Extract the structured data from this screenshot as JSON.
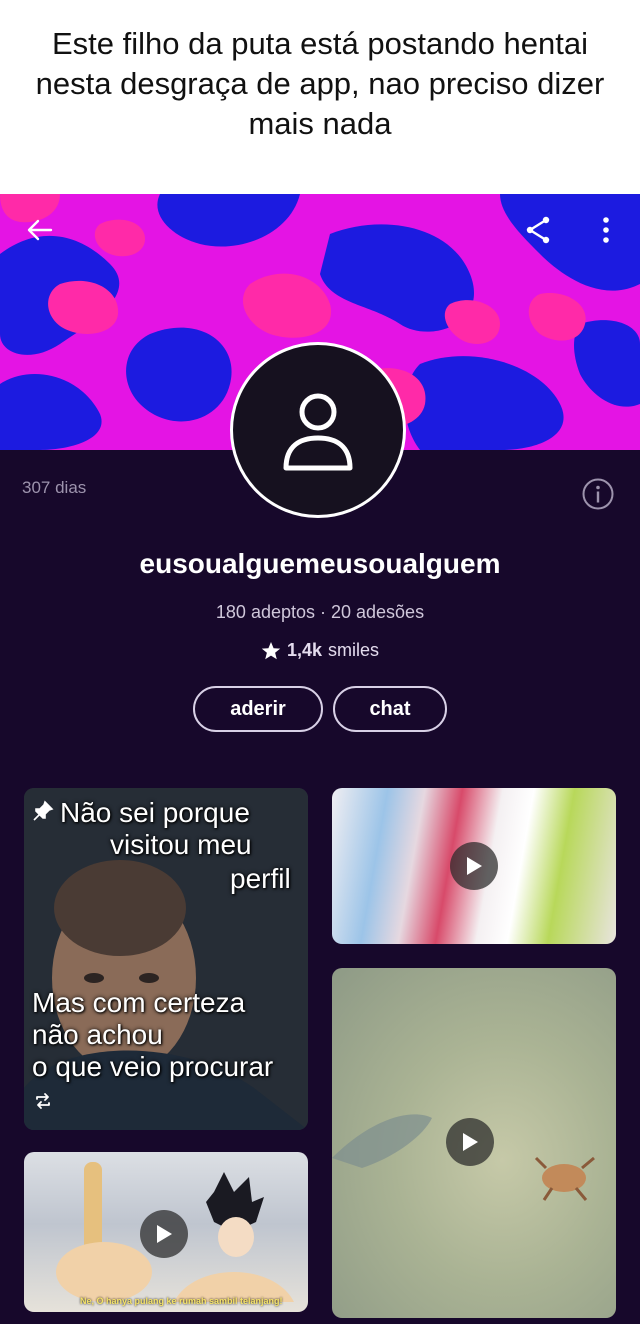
{
  "caption": {
    "text": "Este filho da puta está postando hentai nesta desgraça de app, nao preciso dizer mais nada"
  },
  "header": {
    "back_icon": "back-arrow-icon",
    "share_icon": "share-icon",
    "more_icon": "more-vertical-icon"
  },
  "profile": {
    "days": "307 dias",
    "info_icon": "info-icon",
    "username": "eusoualguemeusoualguem",
    "stats": "180 adeptos · 20 adesões",
    "smiles_count": "1,4k",
    "smiles_label": "smiles",
    "join_label": "aderir",
    "chat_label": "chat",
    "avatar_icon": "default-user-icon"
  },
  "posts": [
    {
      "lines": [
        "Não sei porque",
        "visitou meu",
        "perfil",
        "Mas com certeza",
        "não achou",
        "o que veio procurar"
      ],
      "pinned": true,
      "icon": "repost-icon"
    },
    {
      "type": "video",
      "icon": "play-icon"
    },
    {
      "type": "video",
      "icon": "play-icon"
    },
    {
      "type": "video",
      "icon": "play-icon",
      "subtitle": "Ne, O hanya pulang ke rumah sambil telanjang!"
    }
  ],
  "colors": {
    "banner_magenta": "#e414e4",
    "banner_blue": "#1c1be0",
    "banner_pink": "#ff2aa8",
    "profile_bg": "#17082b"
  }
}
